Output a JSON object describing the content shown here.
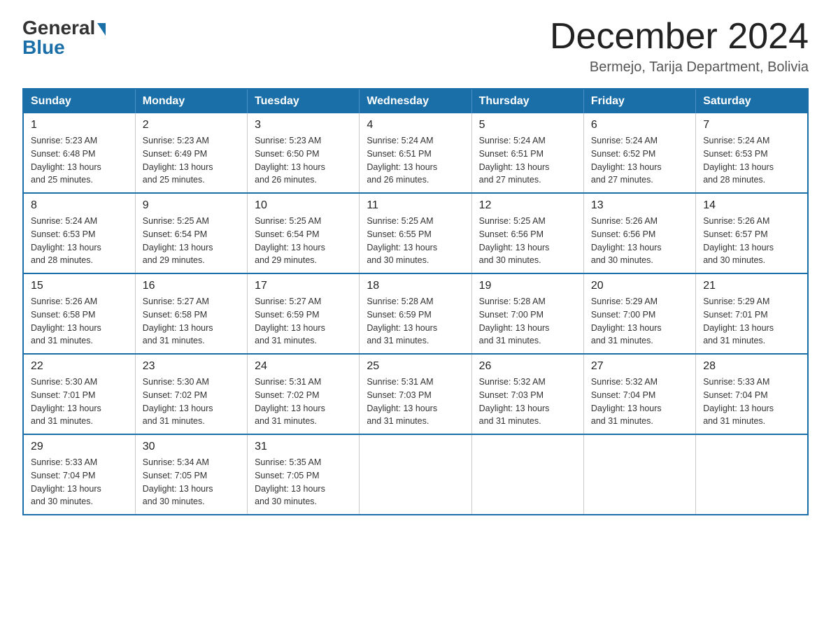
{
  "header": {
    "logo_general": "General",
    "logo_blue": "Blue",
    "main_title": "December 2024",
    "subtitle": "Bermejo, Tarija Department, Bolivia"
  },
  "weekdays": [
    "Sunday",
    "Monday",
    "Tuesday",
    "Wednesday",
    "Thursday",
    "Friday",
    "Saturday"
  ],
  "weeks": [
    [
      {
        "day": "1",
        "sunrise": "5:23 AM",
        "sunset": "6:48 PM",
        "daylight": "13 hours and 25 minutes."
      },
      {
        "day": "2",
        "sunrise": "5:23 AM",
        "sunset": "6:49 PM",
        "daylight": "13 hours and 25 minutes."
      },
      {
        "day": "3",
        "sunrise": "5:23 AM",
        "sunset": "6:50 PM",
        "daylight": "13 hours and 26 minutes."
      },
      {
        "day": "4",
        "sunrise": "5:24 AM",
        "sunset": "6:51 PM",
        "daylight": "13 hours and 26 minutes."
      },
      {
        "day": "5",
        "sunrise": "5:24 AM",
        "sunset": "6:51 PM",
        "daylight": "13 hours and 27 minutes."
      },
      {
        "day": "6",
        "sunrise": "5:24 AM",
        "sunset": "6:52 PM",
        "daylight": "13 hours and 27 minutes."
      },
      {
        "day": "7",
        "sunrise": "5:24 AM",
        "sunset": "6:53 PM",
        "daylight": "13 hours and 28 minutes."
      }
    ],
    [
      {
        "day": "8",
        "sunrise": "5:24 AM",
        "sunset": "6:53 PM",
        "daylight": "13 hours and 28 minutes."
      },
      {
        "day": "9",
        "sunrise": "5:25 AM",
        "sunset": "6:54 PM",
        "daylight": "13 hours and 29 minutes."
      },
      {
        "day": "10",
        "sunrise": "5:25 AM",
        "sunset": "6:54 PM",
        "daylight": "13 hours and 29 minutes."
      },
      {
        "day": "11",
        "sunrise": "5:25 AM",
        "sunset": "6:55 PM",
        "daylight": "13 hours and 30 minutes."
      },
      {
        "day": "12",
        "sunrise": "5:25 AM",
        "sunset": "6:56 PM",
        "daylight": "13 hours and 30 minutes."
      },
      {
        "day": "13",
        "sunrise": "5:26 AM",
        "sunset": "6:56 PM",
        "daylight": "13 hours and 30 minutes."
      },
      {
        "day": "14",
        "sunrise": "5:26 AM",
        "sunset": "6:57 PM",
        "daylight": "13 hours and 30 minutes."
      }
    ],
    [
      {
        "day": "15",
        "sunrise": "5:26 AM",
        "sunset": "6:58 PM",
        "daylight": "13 hours and 31 minutes."
      },
      {
        "day": "16",
        "sunrise": "5:27 AM",
        "sunset": "6:58 PM",
        "daylight": "13 hours and 31 minutes."
      },
      {
        "day": "17",
        "sunrise": "5:27 AM",
        "sunset": "6:59 PM",
        "daylight": "13 hours and 31 minutes."
      },
      {
        "day": "18",
        "sunrise": "5:28 AM",
        "sunset": "6:59 PM",
        "daylight": "13 hours and 31 minutes."
      },
      {
        "day": "19",
        "sunrise": "5:28 AM",
        "sunset": "7:00 PM",
        "daylight": "13 hours and 31 minutes."
      },
      {
        "day": "20",
        "sunrise": "5:29 AM",
        "sunset": "7:00 PM",
        "daylight": "13 hours and 31 minutes."
      },
      {
        "day": "21",
        "sunrise": "5:29 AM",
        "sunset": "7:01 PM",
        "daylight": "13 hours and 31 minutes."
      }
    ],
    [
      {
        "day": "22",
        "sunrise": "5:30 AM",
        "sunset": "7:01 PM",
        "daylight": "13 hours and 31 minutes."
      },
      {
        "day": "23",
        "sunrise": "5:30 AM",
        "sunset": "7:02 PM",
        "daylight": "13 hours and 31 minutes."
      },
      {
        "day": "24",
        "sunrise": "5:31 AM",
        "sunset": "7:02 PM",
        "daylight": "13 hours and 31 minutes."
      },
      {
        "day": "25",
        "sunrise": "5:31 AM",
        "sunset": "7:03 PM",
        "daylight": "13 hours and 31 minutes."
      },
      {
        "day": "26",
        "sunrise": "5:32 AM",
        "sunset": "7:03 PM",
        "daylight": "13 hours and 31 minutes."
      },
      {
        "day": "27",
        "sunrise": "5:32 AM",
        "sunset": "7:04 PM",
        "daylight": "13 hours and 31 minutes."
      },
      {
        "day": "28",
        "sunrise": "5:33 AM",
        "sunset": "7:04 PM",
        "daylight": "13 hours and 31 minutes."
      }
    ],
    [
      {
        "day": "29",
        "sunrise": "5:33 AM",
        "sunset": "7:04 PM",
        "daylight": "13 hours and 30 minutes."
      },
      {
        "day": "30",
        "sunrise": "5:34 AM",
        "sunset": "7:05 PM",
        "daylight": "13 hours and 30 minutes."
      },
      {
        "day": "31",
        "sunrise": "5:35 AM",
        "sunset": "7:05 PM",
        "daylight": "13 hours and 30 minutes."
      },
      null,
      null,
      null,
      null
    ]
  ],
  "labels": {
    "sunrise": "Sunrise:",
    "sunset": "Sunset:",
    "daylight": "Daylight:"
  }
}
